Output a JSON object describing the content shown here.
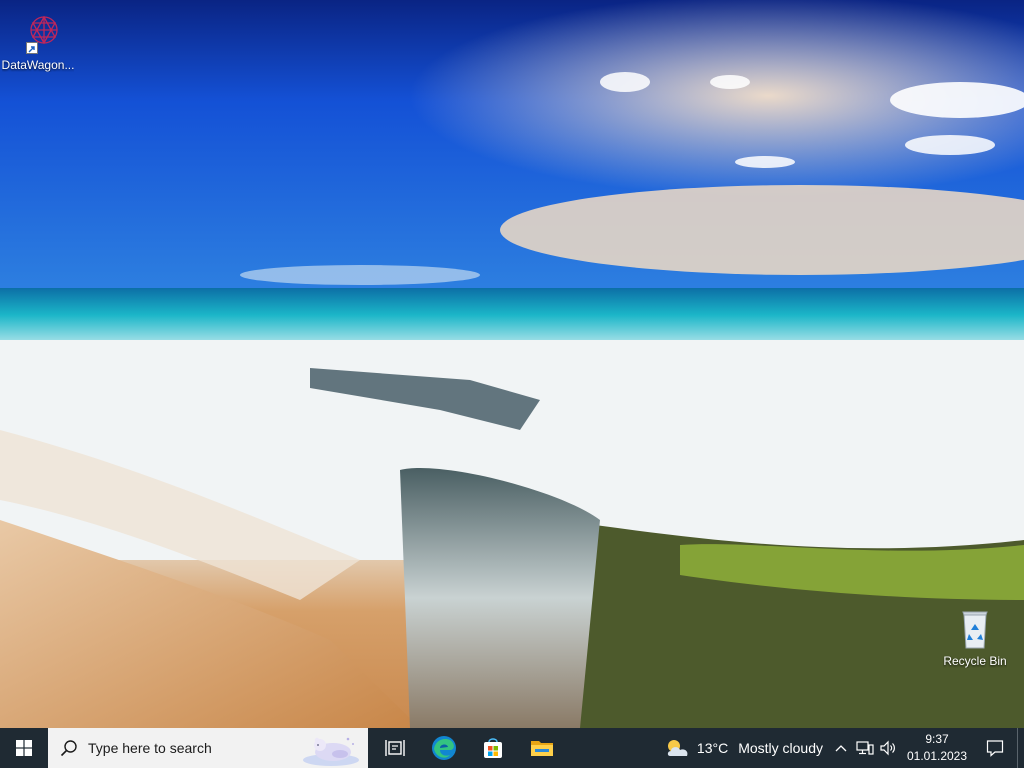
{
  "desktop": {
    "icons": [
      {
        "label": "DataWagon...",
        "icon": "datawagon-app-icon",
        "shortcut": true
      },
      {
        "label": "Recycle Bin",
        "icon": "recycle-bin-icon",
        "shortcut": false
      }
    ]
  },
  "taskbar": {
    "start_icon": "windows-logo-icon",
    "search": {
      "placeholder": "Type here to search"
    },
    "pinned": [
      {
        "name": "task-view",
        "icon": "task-view-icon"
      },
      {
        "name": "microsoft-edge",
        "icon": "edge-icon"
      },
      {
        "name": "microsoft-store",
        "icon": "store-icon"
      },
      {
        "name": "file-explorer",
        "icon": "folder-icon"
      }
    ],
    "weather": {
      "temperature": "13°C",
      "condition": "Mostly cloudy",
      "icon": "partly-cloudy-icon"
    },
    "tray": {
      "icons": [
        "chevron-up-icon",
        "network-icon",
        "volume-icon"
      ]
    },
    "clock": {
      "time": "9:37",
      "date": "01.01.2023"
    },
    "notification_icon": "notification-icon"
  },
  "colors": {
    "taskbar_bg": "#1f2a33",
    "search_bg": "#f2f2f2",
    "accent": "#0078d7"
  }
}
